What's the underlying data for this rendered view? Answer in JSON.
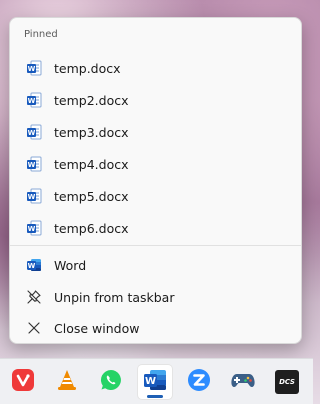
{
  "jump_list": {
    "section_label": "Pinned",
    "pinned_items": [
      {
        "label": "temp.docx",
        "icon": "word-document-icon"
      },
      {
        "label": "temp2.docx",
        "icon": "word-document-icon"
      },
      {
        "label": "temp3.docx",
        "icon": "word-document-icon"
      },
      {
        "label": "temp4.docx",
        "icon": "word-document-icon"
      },
      {
        "label": "temp5.docx",
        "icon": "word-document-icon"
      },
      {
        "label": "temp6.docx",
        "icon": "word-document-icon"
      }
    ],
    "actions": [
      {
        "label": "Word",
        "icon": "word-app-icon"
      },
      {
        "label": "Unpin from taskbar",
        "icon": "unpin-icon"
      },
      {
        "label": "Close window",
        "icon": "close-icon"
      }
    ]
  },
  "taskbar": {
    "apps": [
      {
        "name": "vivaldi",
        "icon": "vivaldi-icon"
      },
      {
        "name": "vlc",
        "icon": "vlc-icon"
      },
      {
        "name": "whatsapp",
        "icon": "whatsapp-icon"
      },
      {
        "name": "word",
        "icon": "word-icon",
        "active": true
      },
      {
        "name": "zoom",
        "icon": "zoom-icon"
      },
      {
        "name": "game-controller",
        "icon": "gamepad-icon"
      },
      {
        "name": "dcs",
        "icon": "dcs-icon",
        "text": "DCS"
      }
    ]
  },
  "colors": {
    "word_blue": "#185abd",
    "menu_bg": "#f9f9f9",
    "vivaldi_red": "#ef3939",
    "vlc_orange": "#f08a00",
    "whatsapp_green": "#25d366",
    "zoom_blue": "#2d8cff"
  }
}
